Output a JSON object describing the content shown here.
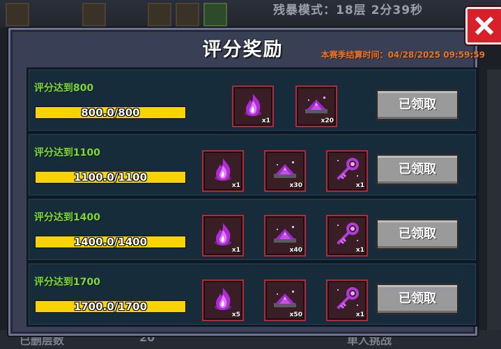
{
  "background": {
    "mode_text": "残暴模式：18层 2分39秒",
    "bottom_left": "已删层数",
    "bottom_mid": "20",
    "bottom_right": "单人挑战"
  },
  "dialog": {
    "title": "评分奖励",
    "season_end": "本赛季结算时间：04/28/2025 09:59:59",
    "close_label": "×"
  },
  "rows": [
    {
      "label": "评分达到800",
      "progress_text": "800.0/800",
      "progress": 1.0,
      "button": "已领取",
      "items": [
        {
          "icon": "purple-flame-icon",
          "qty": "x1"
        },
        {
          "icon": "purple-gem-pile-icon",
          "qty": "x20"
        }
      ]
    },
    {
      "label": "评分达到1100",
      "progress_text": "1100.0/1100",
      "progress": 1.0,
      "button": "已领取",
      "items": [
        {
          "icon": "purple-flame-icon",
          "qty": "x1"
        },
        {
          "icon": "purple-gem-pile-icon",
          "qty": "x30"
        },
        {
          "icon": "purple-key-icon",
          "qty": "x1"
        }
      ]
    },
    {
      "label": "评分达到1400",
      "progress_text": "1400.0/1400",
      "progress": 1.0,
      "button": "已领取",
      "items": [
        {
          "icon": "purple-flame-icon",
          "qty": "x1"
        },
        {
          "icon": "purple-gem-pile-icon",
          "qty": "x40"
        },
        {
          "icon": "purple-key-icon",
          "qty": "x1"
        }
      ]
    },
    {
      "label": "评分达到1700",
      "progress_text": "1700.0/1700",
      "progress": 1.0,
      "button": "已领取",
      "items": [
        {
          "icon": "purple-flame-icon",
          "qty": "x5"
        },
        {
          "icon": "purple-gem-pile-icon",
          "qty": "x50"
        },
        {
          "icon": "purple-key-icon",
          "qty": "x1"
        }
      ]
    }
  ],
  "colors": {
    "accent_green": "#7fd83a",
    "progress_yellow": "#f2c400",
    "close_red": "#d8202a",
    "season_orange": "#e8742a"
  }
}
